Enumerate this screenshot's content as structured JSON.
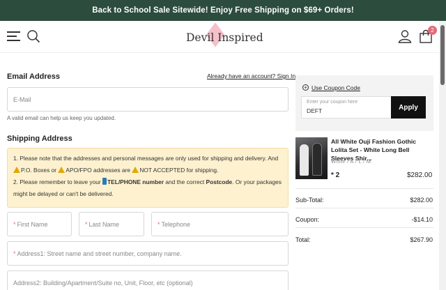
{
  "banner": {
    "text": "Back to School Sale Sitewide! Enjoy Free Shipping on $69+ Orders!"
  },
  "header": {
    "logo_text": "Devil Inspired",
    "cart_count": "2"
  },
  "email": {
    "title": "Email Address",
    "signin_link": "Already have an account? Sign In",
    "placeholder": "E-Mail",
    "hint": "A valid email can help us keep you updated."
  },
  "shipping": {
    "title": "Shipping Address",
    "notice": {
      "line1": "1. Please note that the addresses and personal messages are only used for shipping and delivery. And",
      "po": "P.O. Boxes or",
      "apo": "APO/FPO addresses are",
      "not_accepted": "NOT ACCEPTED for shipping.",
      "line3_a": "2. Please remember to leave your",
      "line3_b": "TEL/PHONE number",
      "line3_c": "and the correct",
      "line3_d": "Postcode",
      "line3_e": ". Or your packages",
      "line4": "might be delayed or can't be delivered."
    },
    "fields": {
      "first_name": "First Name",
      "last_name": "Last Name",
      "telephone": "Telephone",
      "address1": "Address1: Street name and street number, company name.",
      "address2": "Address2: Building/Apartment/Suite no, Unit, Floor, etc (optional)"
    }
  },
  "coupon": {
    "link": "Use Coupon Code",
    "placeholder": "Enter your coupon here",
    "value": "DEFT",
    "apply": "Apply"
  },
  "product": {
    "name": "All White Ouji Fashion Gothic Lolita Set - White Long Bell Sleeves Shir...",
    "options": "White / A / L / M",
    "qty": "* 2",
    "price": "$282.00"
  },
  "summary": [
    {
      "label": "Sub-Total:",
      "value": "$282.00"
    },
    {
      "label": "Coupon:",
      "value": "-$14.10"
    },
    {
      "label": "Total:",
      "value": "$267.90"
    }
  ]
}
